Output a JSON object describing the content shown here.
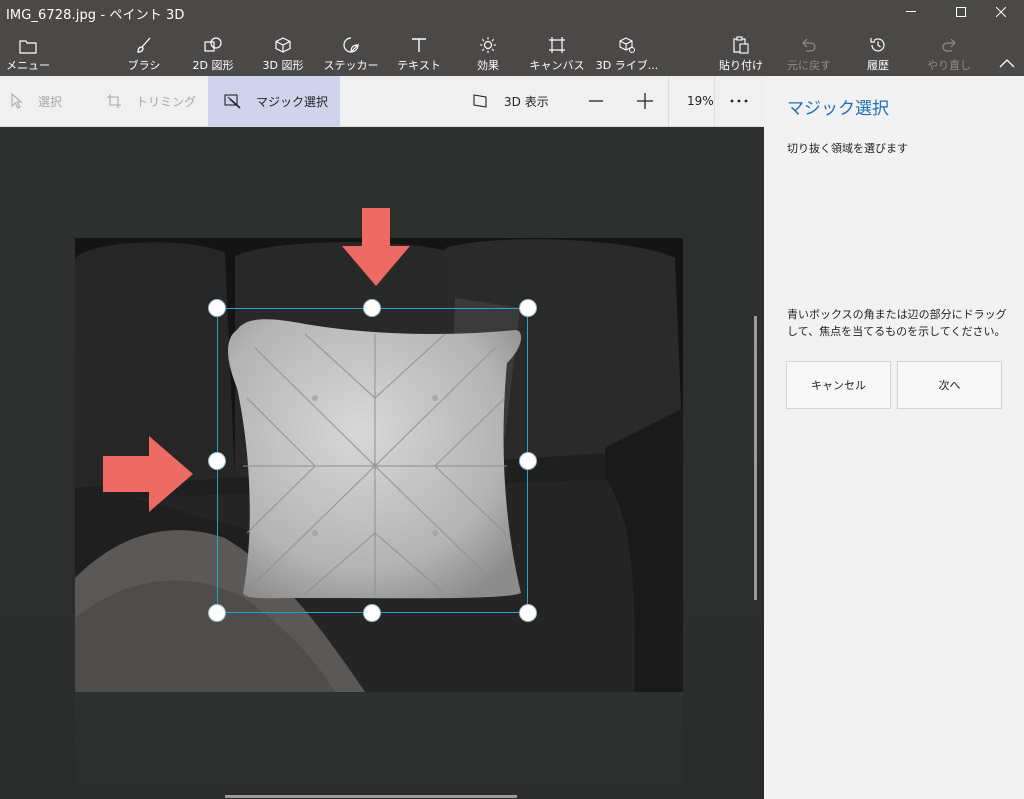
{
  "window": {
    "title": "IMG_6728.jpg - ペイント 3D"
  },
  "ribbon": {
    "menu_label": "メニュー",
    "tools": [
      {
        "label": "ブラシ",
        "icon": "brush-icon"
      },
      {
        "label": "2D 図形",
        "icon": "2d-shapes-icon"
      },
      {
        "label": "3D 図形",
        "icon": "3d-shapes-icon"
      },
      {
        "label": "ステッカー",
        "icon": "stickers-icon"
      },
      {
        "label": "テキスト",
        "icon": "text-icon"
      },
      {
        "label": "効果",
        "icon": "effects-icon"
      },
      {
        "label": "キャンバス",
        "icon": "canvas-icon"
      },
      {
        "label": "3D ライブ...",
        "icon": "3d-library-icon"
      }
    ],
    "paste_label": "貼り付け",
    "undo_label": "元に戻す",
    "history_label": "履歴",
    "redo_label": "やり直し"
  },
  "subbar": {
    "select_label": "選択",
    "trim_label": "トリミング",
    "magic_select_label": "マジック選択",
    "view3d_label": "3D 表示",
    "zoom_label": "19%"
  },
  "panel": {
    "title": "マジック選択",
    "subtitle": "切り抜く領域を選びます",
    "instruction": "青いボックスの角または辺の部分にドラッグして、焦点を当てるものを示してください。",
    "cancel_label": "キャンセル",
    "next_label": "次へ"
  },
  "colors": {
    "accent": "#1f6fb8",
    "selection": "#2aa3c9",
    "arrow": "#ee6a64",
    "chrome": "#4b4848",
    "active_tab": "#cfd3ec"
  }
}
